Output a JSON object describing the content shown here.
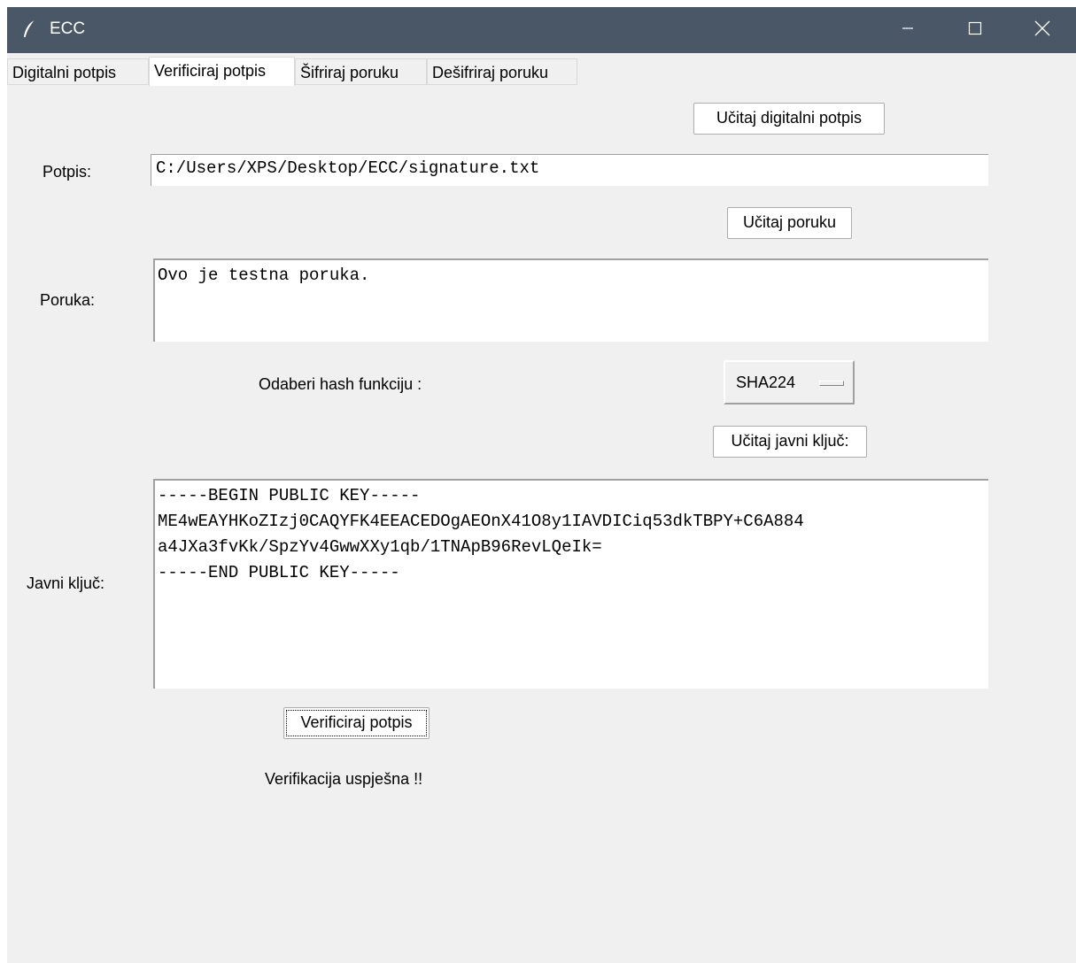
{
  "window": {
    "title": "ECC",
    "icons": {
      "app": "feather-icon",
      "minimize": "minimize-icon",
      "maximize": "maximize-icon",
      "close": "close-icon"
    }
  },
  "tabs": [
    {
      "label": "Digitalni potpis",
      "active": false
    },
    {
      "label": "Verificiraj potpis",
      "active": true
    },
    {
      "label": "Šifriraj poruku",
      "active": false
    },
    {
      "label": "Dešifriraj poruku",
      "active": false
    }
  ],
  "form": {
    "load_signature_button": "Učitaj digitalni potpis",
    "signature_label": "Potpis:",
    "signature_value": "C:/Users/XPS/Desktop/ECC/signature.txt",
    "load_message_button": "Učitaj poruku",
    "message_label": "Poruka:",
    "message_value": "Ovo je testna poruka.",
    "hash_label": "Odaberi hash funkciju :",
    "hash_selected": "SHA224",
    "load_public_key_button": "Učitaj javni ključ:",
    "public_key_label": "Javni ključ:",
    "public_key_value": "-----BEGIN PUBLIC KEY-----\nME4wEAYHKoZIzj0CAQYFK4EEACEDOgAEOnX41O8y1IAVDICiq53dkTBPY+C6A884\na4JXa3fvKk/SpzYv4GwwXXy1qb/1TNApB96RevLQeIk=\n-----END PUBLIC KEY-----",
    "verify_button": "Verificiraj potpis",
    "result_text": "Verifikacija uspješna !!"
  },
  "colors": {
    "titlebar": "#4a5766",
    "window_bg": "#f0f0f0",
    "field_bg": "#ffffff"
  }
}
